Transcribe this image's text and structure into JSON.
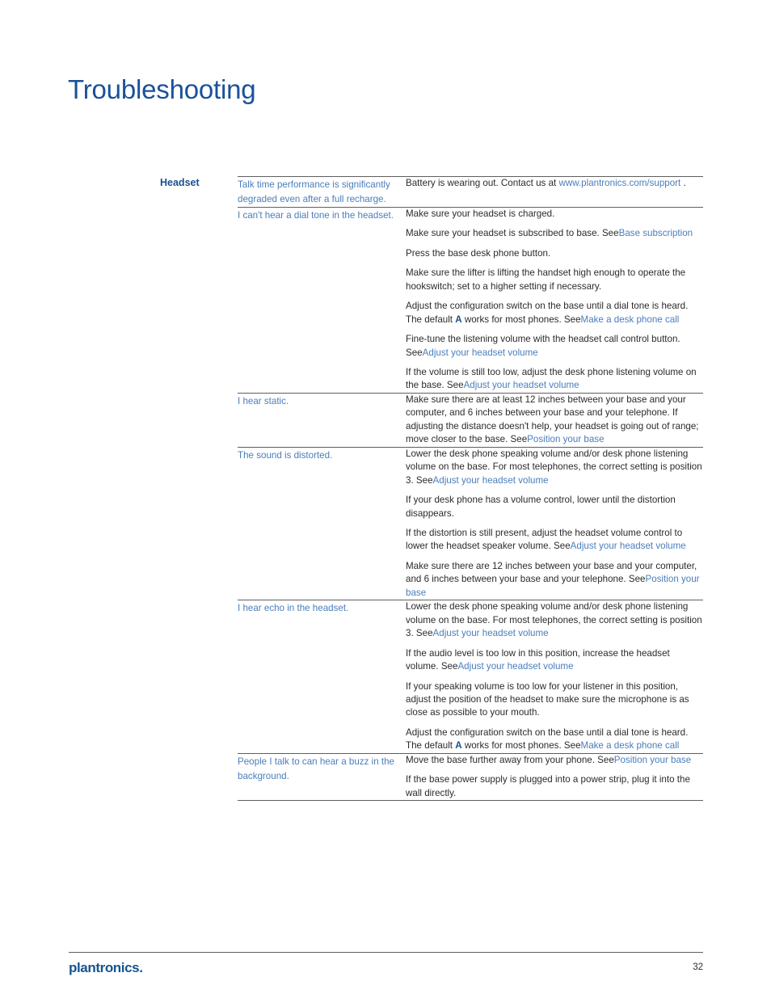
{
  "document": {
    "title": "Troubleshooting",
    "section_label": "Headset",
    "title_color": "#1a5199",
    "link_color": "#4a7ebb",
    "rule_color": "#5f5f5f"
  },
  "footer": {
    "logo": "plantronics",
    "logo_dot": ".",
    "page_number": "32"
  },
  "table": {
    "rows": [
      {
        "symptom": "Talk time performance is significantly degraded even after a full recharge.",
        "solutions": [
          {
            "parts": [
              {
                "t": "text",
                "v": "Battery is wearing out. Contact us at "
              },
              {
                "t": "link",
                "v": "www.plantronics.com/support"
              },
              {
                "t": "text",
                "v": " ."
              }
            ]
          }
        ]
      },
      {
        "symptom": "I can't hear a dial tone in the headset.",
        "solutions": [
          {
            "parts": [
              {
                "t": "text",
                "v": "Make sure your headset is charged."
              }
            ]
          },
          {
            "parts": [
              {
                "t": "text",
                "v": "Make sure your headset is subscribed to base. See"
              },
              {
                "t": "link",
                "v": "Base subscription"
              }
            ]
          },
          {
            "parts": [
              {
                "t": "text",
                "v": "Press the base desk phone button."
              }
            ]
          },
          {
            "parts": [
              {
                "t": "text",
                "v": "Make sure the lifter is lifting the handset high enough to operate the hookswitch; set to a higher setting if necessary."
              }
            ]
          },
          {
            "parts": [
              {
                "t": "text",
                "v": "Adjust the configuration switch on the base until a dial tone is heard. The default "
              },
              {
                "t": "bold",
                "v": "A"
              },
              {
                "t": "text",
                "v": " works for most phones. See"
              },
              {
                "t": "link",
                "v": "Make a desk phone call"
              }
            ]
          },
          {
            "parts": [
              {
                "t": "text",
                "v": "Fine-tune the listening volume with the headset call control button. See"
              },
              {
                "t": "link",
                "v": "Adjust your headset volume"
              }
            ]
          },
          {
            "parts": [
              {
                "t": "text",
                "v": "If the volume is still too low, adjust the desk phone listening volume on the base. See"
              },
              {
                "t": "link",
                "v": "Adjust your headset volume"
              }
            ]
          }
        ]
      },
      {
        "symptom": "I hear static.",
        "solutions": [
          {
            "parts": [
              {
                "t": "text",
                "v": "Make sure there are at least 12 inches between your base and your computer, and 6 inches between your base and your telephone. If adjusting the distance doesn't help, your headset is going out of range; move closer to the base. See"
              },
              {
                "t": "link",
                "v": "Position your base"
              }
            ]
          }
        ]
      },
      {
        "symptom": "The sound is distorted.",
        "solutions": [
          {
            "parts": [
              {
                "t": "text",
                "v": "Lower the desk phone speaking volume and/or desk phone listening volume on the base. For most telephones, the correct setting is position 3. See"
              },
              {
                "t": "link",
                "v": "Adjust your headset volume"
              }
            ]
          },
          {
            "parts": [
              {
                "t": "text",
                "v": "If your desk phone has a volume control, lower until the distortion disappears."
              }
            ]
          },
          {
            "parts": [
              {
                "t": "text",
                "v": "If the distortion is still present, adjust the headset volume control to lower the headset speaker volume. See"
              },
              {
                "t": "link",
                "v": "Adjust your headset volume"
              }
            ]
          },
          {
            "parts": [
              {
                "t": "text",
                "v": "Make sure there are 12 inches between your base and your computer, and 6 inches between your base and your telephone. See"
              },
              {
                "t": "link",
                "v": "Position your base"
              }
            ]
          }
        ]
      },
      {
        "symptom": "I hear echo in the headset.",
        "solutions": [
          {
            "parts": [
              {
                "t": "text",
                "v": "Lower the desk phone speaking volume and/or desk phone listening volume on the base. For most telephones, the correct setting is position 3. See"
              },
              {
                "t": "link",
                "v": "Adjust your headset volume"
              }
            ]
          },
          {
            "parts": [
              {
                "t": "text",
                "v": "If the audio level is too low in this position, increase the headset volume. See"
              },
              {
                "t": "link",
                "v": "Adjust your headset volume"
              }
            ]
          },
          {
            "parts": [
              {
                "t": "text",
                "v": "If your speaking volume is too low for your listener in this position, adjust the position of the headset to make sure the microphone is as close as possible to your mouth."
              }
            ]
          },
          {
            "parts": [
              {
                "t": "text",
                "v": "Adjust the configuration switch on the base until a dial tone is heard. The default "
              },
              {
                "t": "bold",
                "v": "A"
              },
              {
                "t": "text",
                "v": " works for most phones. See"
              },
              {
                "t": "link",
                "v": "Make a desk phone call"
              }
            ]
          }
        ]
      },
      {
        "symptom": "People I talk to can hear a buzz in the background.",
        "solutions": [
          {
            "parts": [
              {
                "t": "text",
                "v": "Move the base further away from your phone. See"
              },
              {
                "t": "link",
                "v": "Position your base"
              }
            ]
          },
          {
            "parts": [
              {
                "t": "text",
                "v": "If the base power supply is plugged into a power strip, plug it into the wall directly."
              }
            ]
          }
        ]
      }
    ]
  }
}
